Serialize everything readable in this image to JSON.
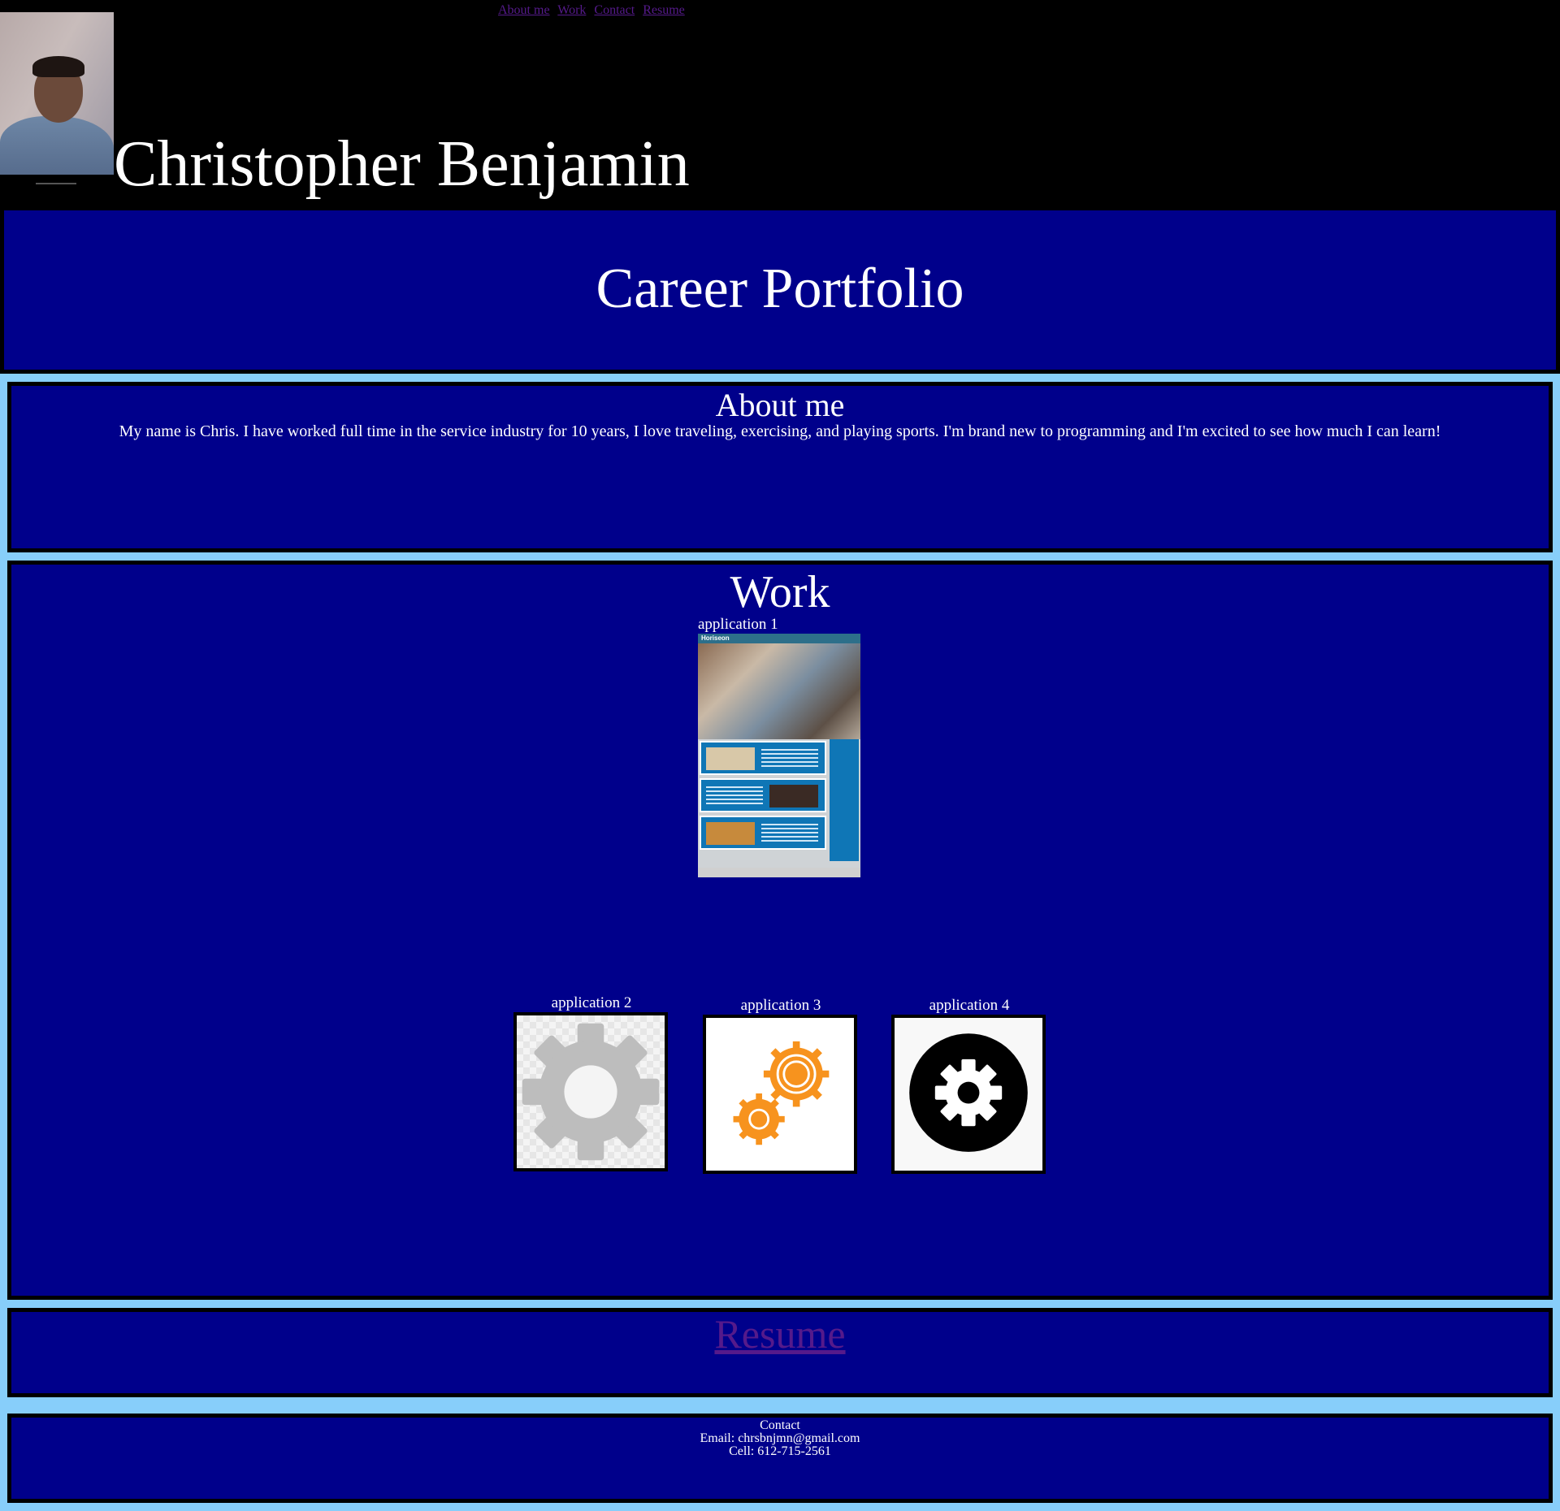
{
  "nav": {
    "links": [
      "About me",
      "Work",
      "Contact",
      "Resume"
    ]
  },
  "header": {
    "name": "Christopher Benjamin"
  },
  "banner": {
    "title": "Career Portfolio"
  },
  "about": {
    "title": "About me",
    "text": "My name is Chris. I have worked full time in the service industry for 10 years, I love traveling, exercising, and playing sports. I'm brand new to programming and I'm excited to see how much I can learn!"
  },
  "work": {
    "title": "Work",
    "apps": [
      {
        "label": "application 1",
        "icon": "horiseon-screenshot",
        "brand": "Horiseon"
      },
      {
        "label": "application 2",
        "icon": "gray-gear-icon"
      },
      {
        "label": "application 3",
        "icon": "orange-gears-icon"
      },
      {
        "label": "application 4",
        "icon": "black-circle-gear-icon"
      }
    ]
  },
  "resume": {
    "link": "Resume"
  },
  "contact": {
    "title": "Contact",
    "email": "Email: chrsbnjmn@gmail.com",
    "cell": "Cell: 612-715-2561"
  },
  "colors": {
    "page_bg": "#87cefa",
    "header_bg": "#000000",
    "section_bg": "#00008b",
    "link": "#551a8b",
    "gear_orange": "#f7931e",
    "gear_gray": "#bdbdbd"
  }
}
